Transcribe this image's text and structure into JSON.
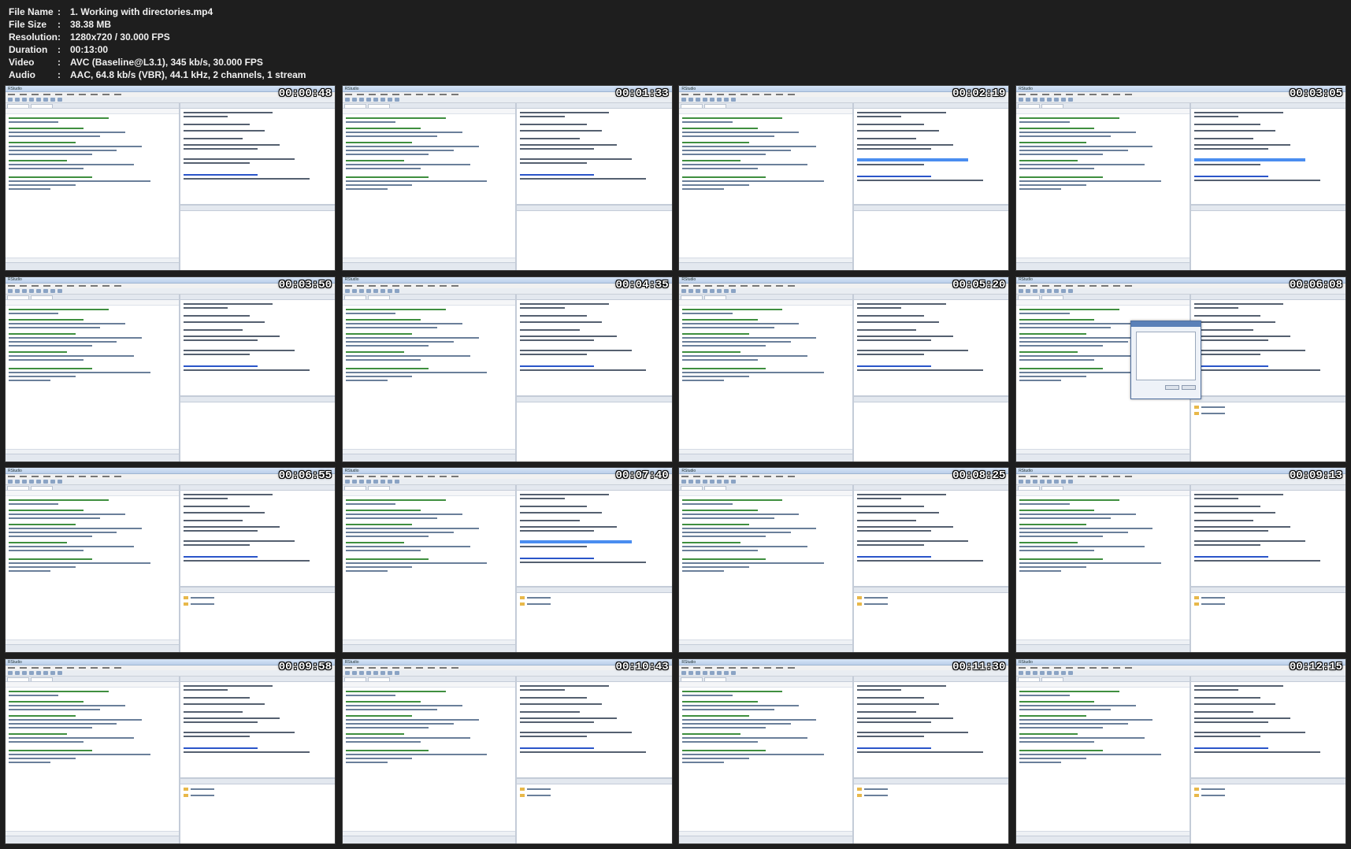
{
  "info": [
    {
      "key": "File Name",
      "sep": ":",
      "value": "1. Working with directories.mp4"
    },
    {
      "key": "File Size",
      "sep": ":",
      "value": "38.38 MB"
    },
    {
      "key": "Resolution",
      "sep": ":",
      "value": "1280x720 / 30.000 FPS"
    },
    {
      "key": "Duration",
      "sep": ":",
      "value": "00:13:00"
    },
    {
      "key": "Video",
      "sep": ":",
      "value": "AVC (Baseline@L3.1), 345 kb/s, 30.000 FPS"
    },
    {
      "key": "Audio",
      "sep": ":",
      "value": "AAC, 64.8 kb/s (VBR), 44.1 kHz, 2 channels, 1 stream"
    }
  ],
  "window_title": "RStudio",
  "thumbnails": [
    {
      "timestamp": "00:00:48",
      "selection": false,
      "dialog": false
    },
    {
      "timestamp": "00:01:33",
      "selection": false,
      "dialog": false
    },
    {
      "timestamp": "00:02:19",
      "selection": true,
      "dialog": false
    },
    {
      "timestamp": "00:03:05",
      "selection": true,
      "dialog": false
    },
    {
      "timestamp": "00:03:50",
      "selection": false,
      "dialog": false
    },
    {
      "timestamp": "00:04:35",
      "selection": false,
      "dialog": false
    },
    {
      "timestamp": "00:05:20",
      "selection": false,
      "dialog": false
    },
    {
      "timestamp": "00:06:08",
      "selection": false,
      "dialog": true
    },
    {
      "timestamp": "00:06:55",
      "selection": false,
      "dialog": false
    },
    {
      "timestamp": "00:07:40",
      "selection": true,
      "dialog": false
    },
    {
      "timestamp": "00:08:25",
      "selection": false,
      "dialog": false
    },
    {
      "timestamp": "00:09:13",
      "selection": false,
      "dialog": false
    },
    {
      "timestamp": "00:09:58",
      "selection": false,
      "dialog": false
    },
    {
      "timestamp": "00:10:43",
      "selection": false,
      "dialog": false
    },
    {
      "timestamp": "00:11:30",
      "selection": false,
      "dialog": false
    },
    {
      "timestamp": "00:12:15",
      "selection": false,
      "dialog": false
    }
  ]
}
